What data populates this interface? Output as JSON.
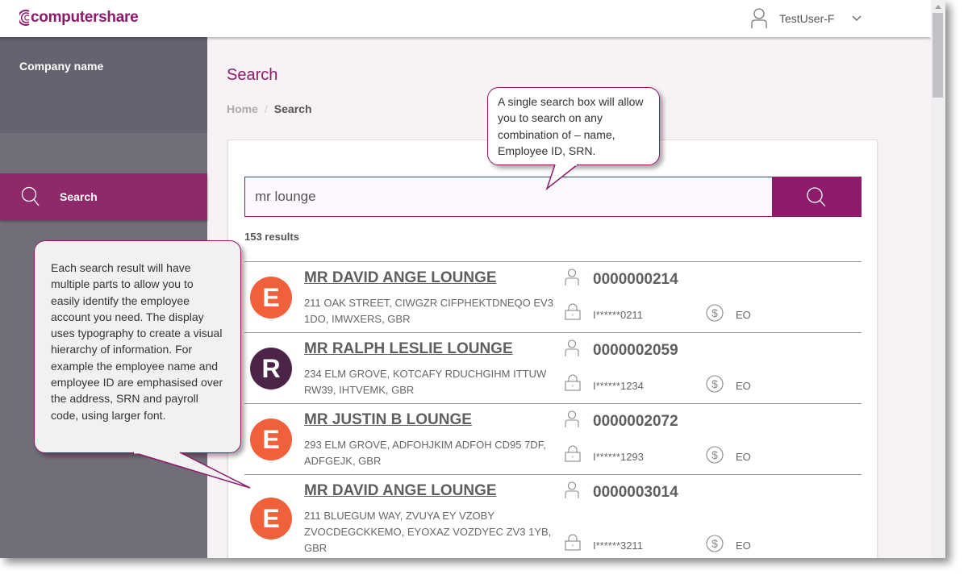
{
  "header": {
    "logo_text": "computershare",
    "user_name": "TestUser-F",
    "icons": {
      "user": "user-icon",
      "dropdown": "chevron-down-icon"
    }
  },
  "sidebar": {
    "company_name": "Company name",
    "items": [
      {
        "label": "Search",
        "icon": "search-icon",
        "active": true
      }
    ]
  },
  "main": {
    "title": "Search",
    "breadcrumb": {
      "home": "Home",
      "separator": "/",
      "current": "Search"
    },
    "search": {
      "value": "mr lounge",
      "placeholder": ""
    },
    "results_count": "153 results",
    "results": [
      {
        "initial": "E",
        "avatar_color": "#f0603a",
        "name": "MR DAVID ANGE LOUNGE",
        "address": "211 OAK STREET, CIWGZR CIFPHEKTDNEQO EV3 1DO, IMWXERS, GBR",
        "employee_id": "0000000214",
        "srn": "I******0211",
        "payroll": "EO"
      },
      {
        "initial": "R",
        "avatar_color": "#4c2447",
        "name": "MR RALPH LESLIE LOUNGE",
        "address": "234 ELM GROVE, KOTCAFY RDUCHGIHM ITTUW RW39, IHTVEMK, GBR",
        "employee_id": "0000002059",
        "srn": "I******1234",
        "payroll": "EO"
      },
      {
        "initial": "E",
        "avatar_color": "#f0603a",
        "name": "MR JUSTIN B LOUNGE",
        "address": "293 ELM GROVE, ADFOHJKIM ADFOH CD95 7DF, ADFGEJK, GBR",
        "employee_id": "0000002072",
        "srn": "I******1293",
        "payroll": "EO"
      },
      {
        "initial": "E",
        "avatar_color": "#f0603a",
        "name": "MR DAVID ANGE LOUNGE",
        "address": "211 BLUEGUM WAY, ZVUYA EY VZOBY ZVOCDEGCKKEMO, EYOXAZ VOZDYEC ZV3 1YB, GBR",
        "employee_id": "0000003014",
        "srn": "I******3211",
        "payroll": "EO"
      }
    ]
  },
  "callouts": {
    "search_box": "A single search box will allow you to search on any combination of – name, Employee ID, SRN.",
    "results": "Each search result will have multiple parts to allow you to easily identify the employee account you need. The display uses typography to create a visual hierarchy of information. For example the employee name and employee ID are emphasised over the address, SRN and payroll code, using larger font."
  },
  "colors": {
    "brand": "#8e1a6b",
    "sidebar": "#716e79",
    "sidebar_company": "#64636f",
    "sidebar_active": "#8e2a6a"
  }
}
